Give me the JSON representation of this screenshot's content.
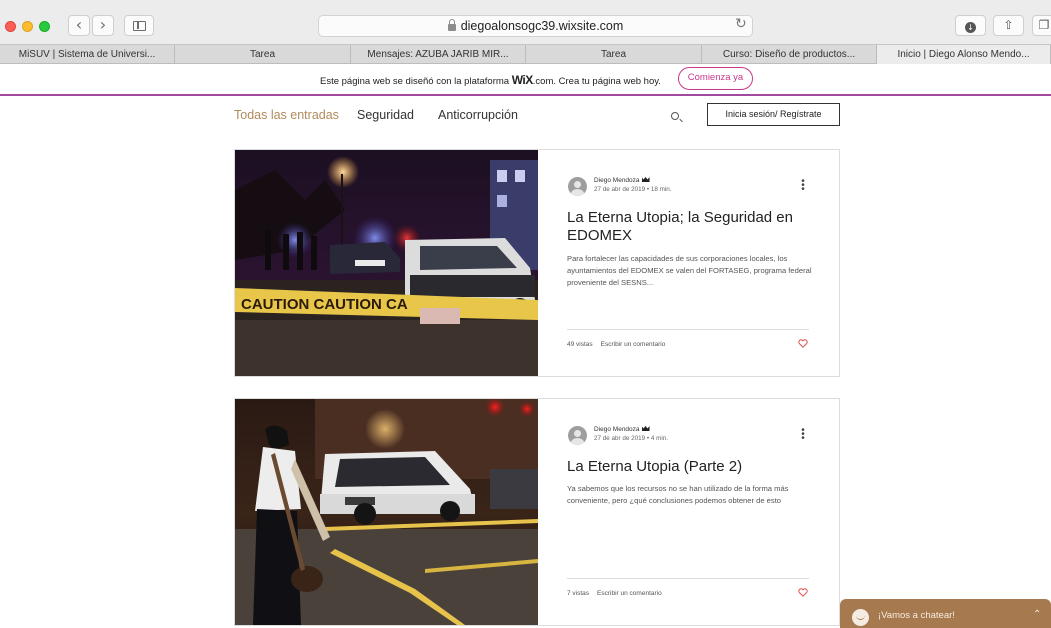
{
  "browser": {
    "url": "diegoalonsogc39.wixsite.com",
    "tabs": [
      "MiSUV | Sistema de Universi...",
      "Tarea",
      "Mensajes: AZUBA JARIB MIR...",
      "Tarea",
      "Curso: Diseño de productos...",
      "Inicio | Diego Alonso Mendo..."
    ]
  },
  "wix_banner": {
    "text_before": "Este página web se diseñó con la plataforma ",
    "logo": "WiX",
    "text_after": ".com. Crea tu página web hoy.",
    "cta": "Comienza ya",
    "accent_color": "#a24aa0"
  },
  "nav": {
    "categories": [
      "Todas las entradas",
      "Seguridad",
      "Anticorrupción"
    ],
    "active_color": "#b38a5c",
    "login": "Inicia sesión/ Regístrate"
  },
  "posts": [
    {
      "author": "Diego Mendoza",
      "meta": "27 de abr de 2019  •  18 min.",
      "title": "La Eterna Utopia; la Seguridad en EDOMEX",
      "excerpt": "Para fortalecer las capacidades de sus corporaciones locales, los ayuntamientos del EDOMEX se valen del FORTASEG, programa federal proveniente del SESNS...",
      "views": "49 vistas",
      "comment": "Escribir un comentario",
      "tape_text": "CAUTION CAUTION CA"
    },
    {
      "author": "Diego Mendoza",
      "meta": "27 de abr de 2019  •  4 min.",
      "title": "La Eterna Utopia (Parte 2)",
      "excerpt": "Ya sabemos que los recursos no se han utilizado de la forma más conveniente, pero ¿qué conclusiones podemos obtener de esto",
      "views": "7 vistas",
      "comment": "Escribir un comentario"
    }
  ],
  "chat": {
    "label": "¡Vamos a chatear!",
    "color": "#a67a4e"
  }
}
